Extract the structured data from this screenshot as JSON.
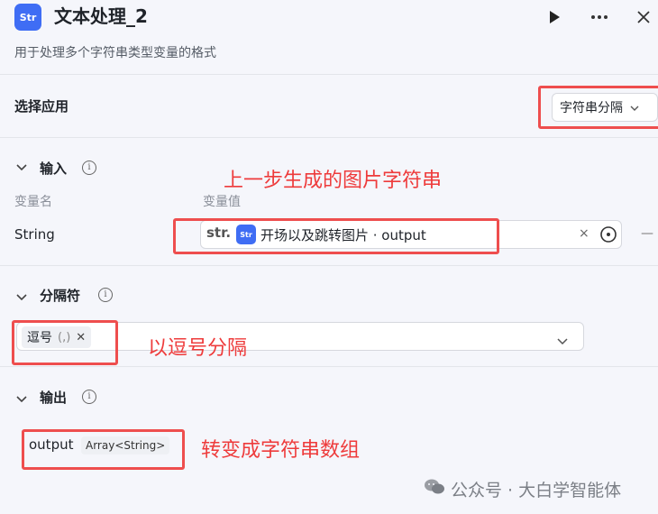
{
  "header": {
    "app_icon_text": "Str",
    "title": "文本处理_2",
    "subtitle": "用于处理多个字符串类型变量的格式",
    "run_icon": "play-icon",
    "more_icon": "more-horizontal-icon",
    "close_icon": "close-icon"
  },
  "app_select": {
    "label": "选择应用",
    "value": "字符串分隔"
  },
  "input_section": {
    "label": "输入",
    "col_name": "变量名",
    "col_value": "变量值",
    "var_name": "String",
    "str_tag": "str.",
    "ref_icon_text": "Str",
    "ref_value": "开场以及跳转图片 · output",
    "clear": "×",
    "remove": "—"
  },
  "separator_section": {
    "label": "分隔符",
    "chip_text": "逗号",
    "chip_symbol": "(,)",
    "chip_remove": "✕"
  },
  "output_section": {
    "label": "输出",
    "name": "output",
    "type": "Array<String>"
  },
  "annotations": {
    "input_note": "上一步生成的图片字符串",
    "separator_note": "以逗号分隔",
    "output_note": "转变成字符串数组"
  },
  "watermark": "公众号 · 大白学智能体",
  "colors": {
    "accent": "#3f6df4",
    "annotation_red": "#ee4e4e",
    "background": "#f5f6fb"
  }
}
